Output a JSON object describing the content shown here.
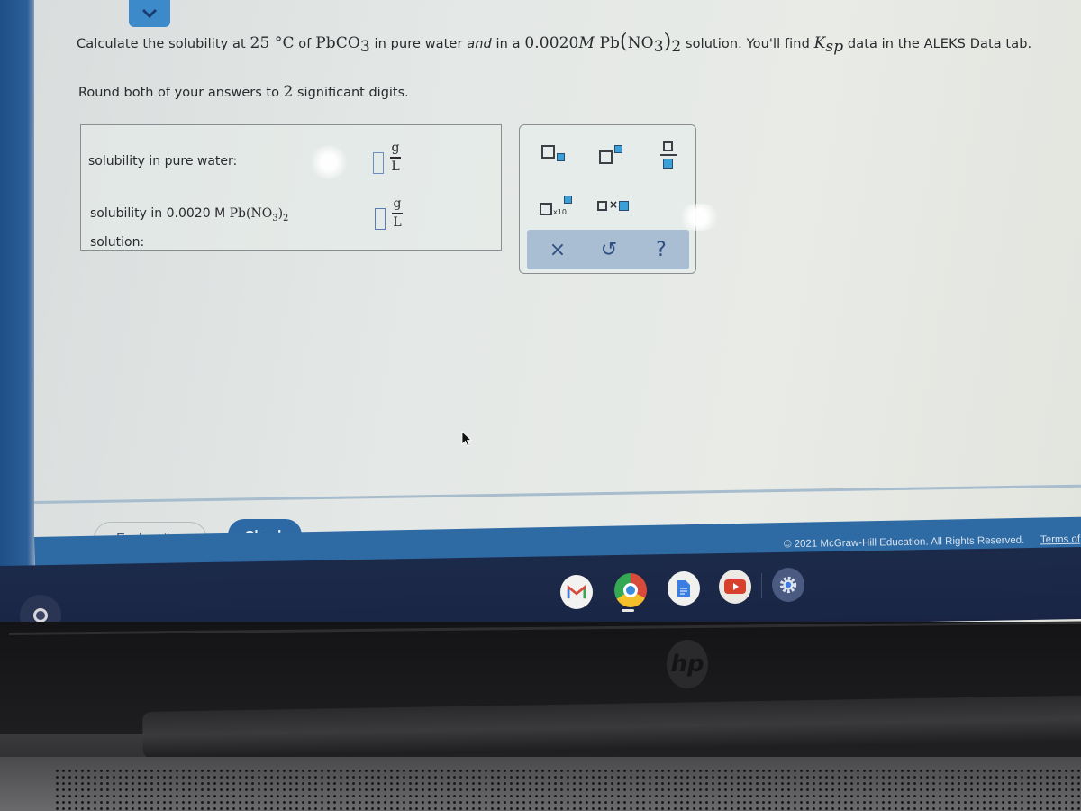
{
  "question": {
    "prefix": "Calculate the solubility at ",
    "temperature": "25",
    "temp_unit": " °C",
    "of": " of ",
    "compound": "PbCO",
    "compound_sub": "3",
    "mid": " in pure water ",
    "and": "and",
    "mid2": " in a ",
    "concentration": "0.0020",
    "molar": "M",
    "salt_pb": " Pb",
    "salt_no": "NO",
    "salt_no_sub": "3",
    "salt_sub": "2",
    "suffix": " solution. You'll find ",
    "k": "K",
    "k_sub": "sp",
    "suffix2": " data in the ALEKS Data tab."
  },
  "instruction": {
    "prefix": "Round both of your answers to ",
    "digits": "2",
    "suffix": " significant digits."
  },
  "answers": [
    {
      "label": "solubility in pure water:",
      "value": "",
      "unit_num": "g",
      "unit_den": "L"
    },
    {
      "label_prefix": "solubility in 0.0020 ",
      "label_molar": "M",
      "label_salt": " Pb(NO",
      "label_salt_sub1": "3",
      "label_salt_close": ")",
      "label_salt_sub2": "2",
      "label_line2": "solution:",
      "value": "",
      "unit_num": "g",
      "unit_den": "L"
    }
  ],
  "palette": {
    "buttons": [
      "subscript",
      "superscript",
      "fraction",
      "scientific-notation",
      "multiply"
    ],
    "sci_label": "x10",
    "times_label": "×",
    "clear_label": "×",
    "undo_label": "↺",
    "help_label": "?"
  },
  "buttons": {
    "explanation": "Explanation",
    "check": "Check"
  },
  "footer": {
    "copyright": "© 2021 McGraw-Hill Education. All Rights Reserved.",
    "terms": "Terms of"
  },
  "shelf": {
    "apps": [
      "Gmail",
      "Chrome",
      "Docs",
      "YouTube",
      "Settings"
    ]
  },
  "colors": {
    "accent": "#2d6aa5",
    "palette_blue": "#3aa0d8",
    "shelf": "#1c2a4a"
  },
  "laptop": {
    "brand": "hp"
  }
}
